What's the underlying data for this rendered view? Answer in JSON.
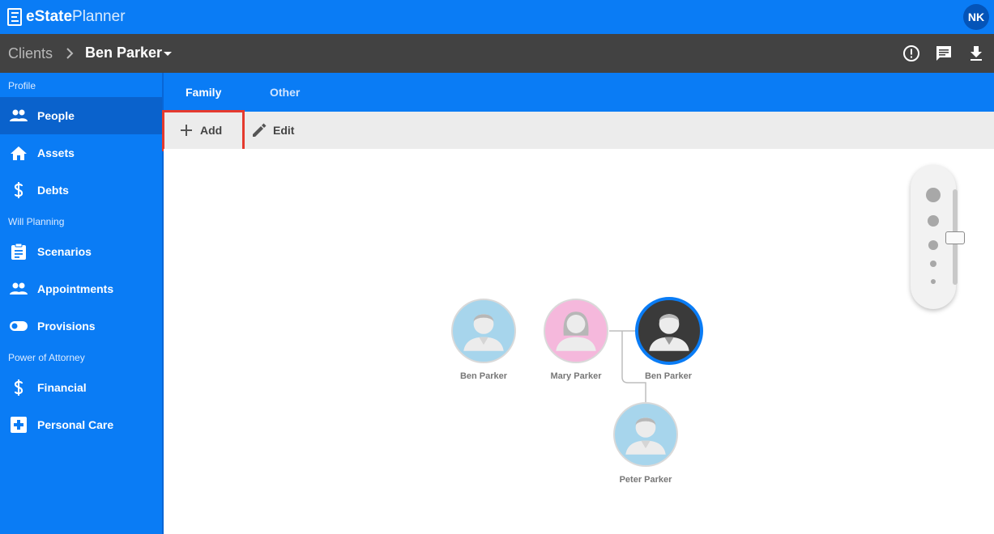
{
  "app": {
    "logo_bold": "eState",
    "logo_light": "Planner",
    "user_initials": "NK"
  },
  "breadcrumb": {
    "root": "Clients",
    "current": "Ben Parker"
  },
  "sidebar": {
    "sections": [
      {
        "title": "Profile",
        "items": [
          {
            "label": "People",
            "icon": "people-icon",
            "active": true
          },
          {
            "label": "Assets",
            "icon": "home-icon"
          },
          {
            "label": "Debts",
            "icon": "dollar-icon"
          }
        ]
      },
      {
        "title": "Will Planning",
        "items": [
          {
            "label": "Scenarios",
            "icon": "clipboard-icon"
          },
          {
            "label": "Appointments",
            "icon": "people-icon"
          },
          {
            "label": "Provisions",
            "icon": "toggle-icon"
          }
        ]
      },
      {
        "title": "Power of Attorney",
        "items": [
          {
            "label": "Financial",
            "icon": "dollar-icon"
          },
          {
            "label": "Personal Care",
            "icon": "medical-cross-icon"
          }
        ]
      }
    ]
  },
  "tabs": [
    {
      "label": "Family",
      "active": true
    },
    {
      "label": "Other",
      "active": false
    }
  ],
  "toolbar": {
    "add_label": "Add",
    "edit_label": "Edit"
  },
  "family_tree": {
    "people": [
      {
        "name": "Ben Parker",
        "gender": "male",
        "selected": false
      },
      {
        "name": "Mary Parker",
        "gender": "female",
        "selected": false
      },
      {
        "name": "Ben Parker",
        "gender": "male",
        "selected": true
      },
      {
        "name": "Peter Parker",
        "gender": "male",
        "selected": false
      }
    ]
  },
  "colors": {
    "brand_blue": "#0a7cf5",
    "sidebar_active": "#0a62cc",
    "header_dark": "#424242",
    "highlight_red": "#e53a2e",
    "male_avatar": "#a7d5ec",
    "female_avatar": "#f5b8dc",
    "selected_avatar": "#3a3a3a"
  }
}
